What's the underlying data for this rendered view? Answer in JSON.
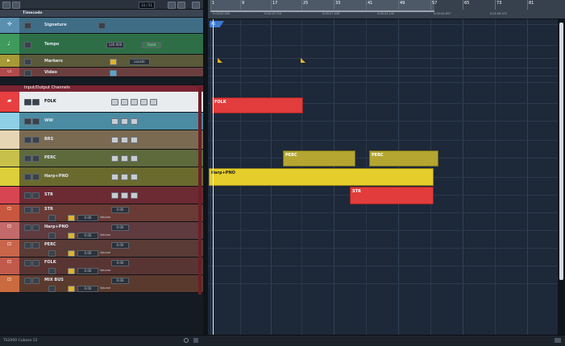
{
  "toolbar": {
    "counter": "33 / 51"
  },
  "ruler": {
    "bars": [
      "1",
      "9",
      "17",
      "25",
      "33",
      "41",
      "49",
      "57",
      "65",
      "73",
      "81"
    ],
    "times": [
      "0:00:00.000",
      "0:00:13.714",
      "0:00:27.428",
      "0:00:41.142",
      "0:00:54.857",
      "0:01:08.571"
    ]
  },
  "arrange_tag": "A1",
  "tracks": {
    "timecode": "Timecode",
    "signature": "Signature",
    "tempo": "Tempo",
    "tempo_value": "120.000",
    "tempo_mode": "Fixed",
    "markers": "Markers",
    "markers_locate": "Locate",
    "video": "Video",
    "io_group": "Input/Output Channels",
    "folk": "FOLK",
    "ww": "WW",
    "brs": "BRS",
    "perc": "PERC",
    "harp": "Harp+PNO",
    "str": "STR",
    "out_str": "STR",
    "out_harp": "Harp+PNO",
    "out_perc": "PERC",
    "out_folk": "FOLK",
    "mix_bus": "MIX BUS",
    "volume_label": "Volume",
    "db_value": "0.00"
  },
  "parts": {
    "folk": "FOLK",
    "perc1": "PERC",
    "perc2": "PERC",
    "harp": "Harp+PNO",
    "str": "STR"
  },
  "status": {
    "text": "TS2000 Cubase 12"
  },
  "colors": {
    "folk": "#e84040",
    "perc": "#c6b52b",
    "harp": "#e0c92c",
    "str": "#e23a3a",
    "io_group": "#7a2432"
  }
}
